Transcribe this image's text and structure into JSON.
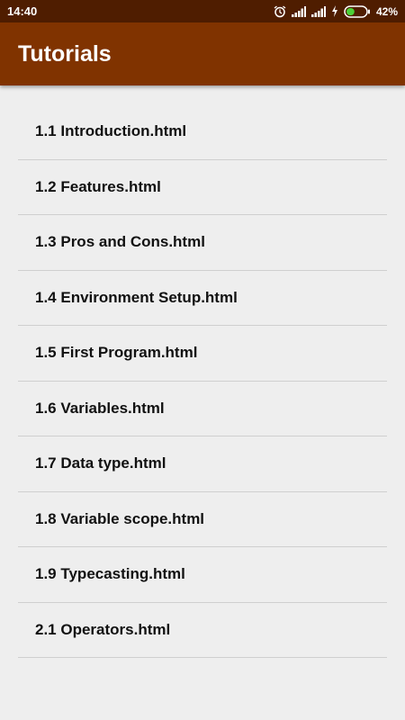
{
  "status_bar": {
    "time": "14:40",
    "battery_percent": "42%",
    "battery_level": 0.42,
    "icons": [
      "alarm-icon",
      "signal-icon",
      "signal-icon",
      "charging-icon",
      "battery-icon"
    ]
  },
  "app_bar": {
    "title": "Tutorials",
    "color": "#803300"
  },
  "tutorials": [
    {
      "label": "1.1 Introduction.html"
    },
    {
      "label": "1.2 Features.html"
    },
    {
      "label": "1.3 Pros and Cons.html"
    },
    {
      "label": "1.4 Environment Setup.html"
    },
    {
      "label": "1.5 First Program.html"
    },
    {
      "label": "1.6 Variables.html"
    },
    {
      "label": "1.7 Data type.html"
    },
    {
      "label": "1.8 Variable scope.html"
    },
    {
      "label": "1.9 Typecasting.html"
    },
    {
      "label": "2.1 Operators.html"
    }
  ]
}
